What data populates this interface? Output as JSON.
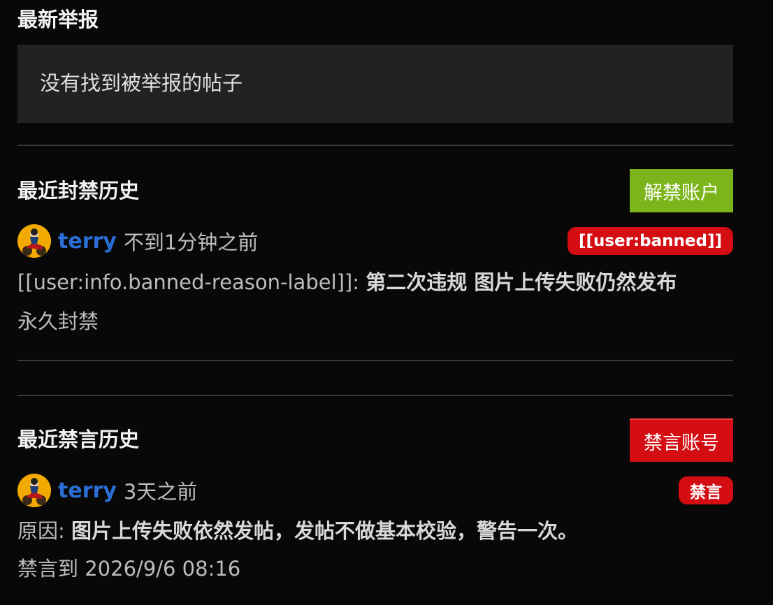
{
  "reports": {
    "title": "最新举报",
    "empty_text": "没有找到被举报的帖子"
  },
  "bans": {
    "title": "最近封禁历史",
    "unban_button": "解禁账户",
    "entry": {
      "username": "terry",
      "time": "不到1分钟之前",
      "badge": "[[user:banned]]",
      "reason_label": "[[user:info.banned-reason-label]]:",
      "reason_text": "第二次违规 图片上传失败仍然发布",
      "expiry": "永久封禁"
    }
  },
  "mutes": {
    "title": "最近禁言历史",
    "mute_button": "禁言账号",
    "entry": {
      "username": "terry",
      "time": "3天之前",
      "badge": "禁言",
      "reason_label": "原因:",
      "reason_text": "图片上传失败依然发帖，发帖不做基本校验，警告一次。",
      "expiry": "禁言到 2026/9/6 08:16"
    }
  },
  "colors": {
    "background": "#080808",
    "box": "#222222",
    "green_button": "#7bb51b",
    "red": "#d40d12",
    "username": "#2b6fd6"
  },
  "icons": {
    "avatar": "user-avatar-motorbike"
  }
}
